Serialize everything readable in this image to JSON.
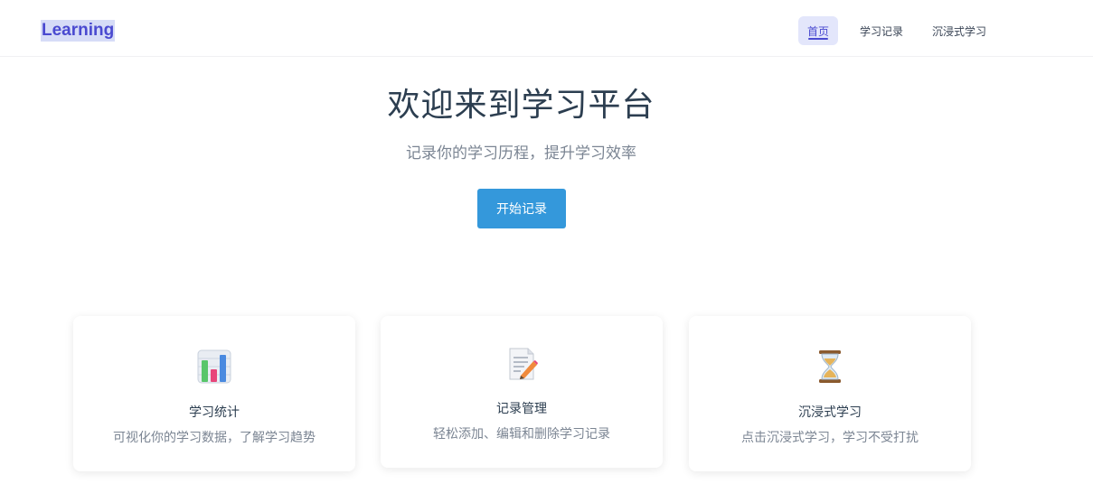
{
  "header": {
    "logo": "Learning",
    "nav": [
      {
        "label": "首页",
        "active": true
      },
      {
        "label": "学习记录",
        "active": false
      },
      {
        "label": "沉浸式学习",
        "active": false
      }
    ]
  },
  "hero": {
    "title": "欢迎来到学习平台",
    "subtitle": "记录你的学习历程，提升学习效率",
    "button_label": "开始记录"
  },
  "features": [
    {
      "icon": "bar-chart-icon",
      "title": "学习统计",
      "description": "可视化你的学习数据，了解学习趋势"
    },
    {
      "icon": "memo-pencil-icon",
      "title": "记录管理",
      "description": "轻松添加、编辑和删除学习记录"
    },
    {
      "icon": "hourglass-icon",
      "title": "沉浸式学习",
      "description": "点击沉浸式学习，学习不受打扰"
    }
  ],
  "colors": {
    "accent": "#4a4ad0",
    "button": "#3498db",
    "text": "#2c3e50",
    "muted": "#7b8593"
  }
}
